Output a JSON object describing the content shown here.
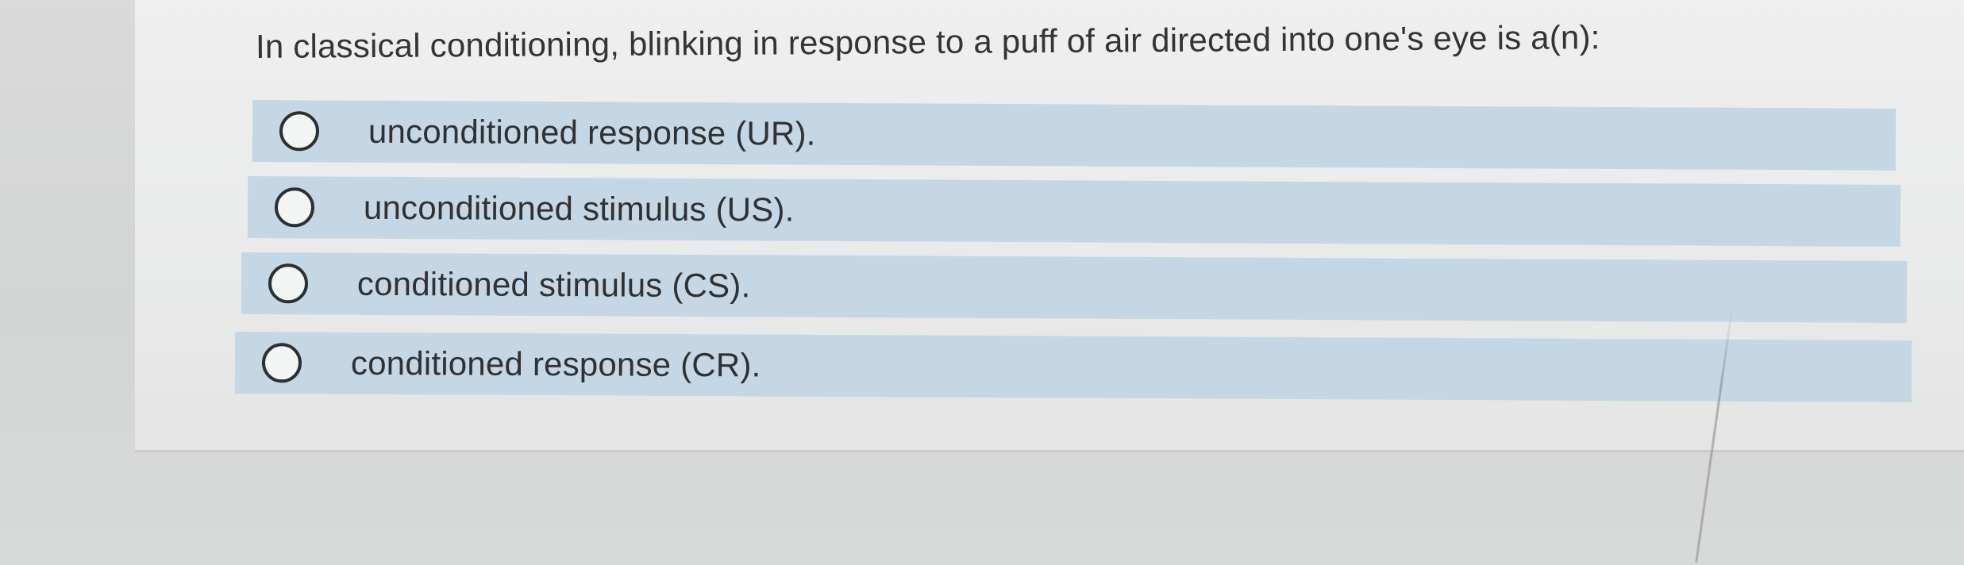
{
  "question": {
    "text": "In classical conditioning, blinking in response to a puff of air directed into one's eye is a(n):"
  },
  "options": [
    {
      "label": "unconditioned response (UR).",
      "selected": false
    },
    {
      "label": "unconditioned stimulus (US).",
      "selected": false
    },
    {
      "label": "conditioned stimulus (CS).",
      "selected": false
    },
    {
      "label": "conditioned response (CR).",
      "selected": false
    }
  ],
  "colors": {
    "option_background": "#c5d7e4",
    "card_background": "#eeefee",
    "page_background": "#d9dad9",
    "text": "#333435"
  }
}
